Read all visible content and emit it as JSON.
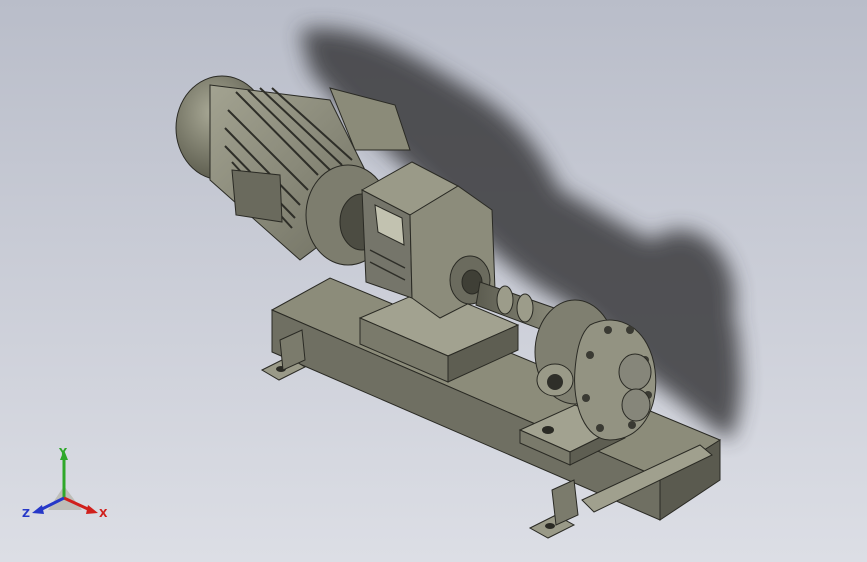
{
  "viewport": {
    "background_top": "#b9bdc9",
    "background_bottom": "#dcdee5"
  },
  "model": {
    "components": [
      "motor",
      "gear-reducer",
      "coupling",
      "gear-pump",
      "base-frame"
    ],
    "metal_color": "#8a8a78",
    "shadow_color": "#3a3a3e"
  },
  "triad": {
    "x_label": "X",
    "y_label": "Y",
    "z_label": "Z",
    "x_color": "#d0201c",
    "y_color": "#2fa82a",
    "z_color": "#2638c8"
  }
}
